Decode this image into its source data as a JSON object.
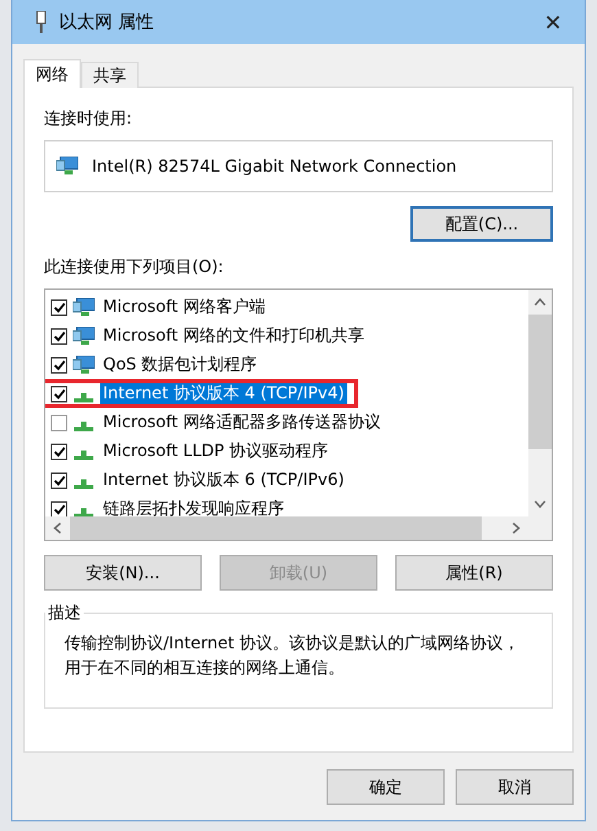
{
  "window": {
    "title": "以太网 属性",
    "close": "✕"
  },
  "tabs": [
    {
      "label": "网络",
      "selected": true
    },
    {
      "label": "共享",
      "selected": false
    }
  ],
  "connect_using": {
    "label": "连接时使用:",
    "adapter": "Intel(R) 82574L Gigabit Network Connection",
    "configure_button": "配置(C)..."
  },
  "items_label": "此连接使用下列项目(O):",
  "items": [
    {
      "label": "Microsoft 网络客户端",
      "kind": "client",
      "checked": true,
      "selected": false,
      "annotated": false
    },
    {
      "label": "Microsoft 网络的文件和打印机共享",
      "kind": "client",
      "checked": true,
      "selected": false,
      "annotated": false
    },
    {
      "label": "QoS 数据包计划程序",
      "kind": "client",
      "checked": true,
      "selected": false,
      "annotated": false
    },
    {
      "label": "Internet 协议版本 4 (TCP/IPv4)",
      "kind": "protocol",
      "checked": true,
      "selected": true,
      "annotated": true
    },
    {
      "label": "Microsoft 网络适配器多路传送器协议",
      "kind": "protocol",
      "checked": false,
      "selected": false,
      "annotated": false
    },
    {
      "label": "Microsoft LLDP 协议驱动程序",
      "kind": "protocol",
      "checked": true,
      "selected": false,
      "annotated": false
    },
    {
      "label": "Internet 协议版本 6 (TCP/IPv6)",
      "kind": "protocol",
      "checked": true,
      "selected": false,
      "annotated": false
    },
    {
      "label": "链路层拓扑发现响应程序",
      "kind": "protocol",
      "checked": true,
      "selected": false,
      "annotated": false
    }
  ],
  "item_buttons": [
    {
      "label": "安装(N)...",
      "disabled": false
    },
    {
      "label": "卸载(U)",
      "disabled": true
    },
    {
      "label": "属性(R)",
      "disabled": false
    }
  ],
  "description": {
    "title": "描述",
    "text": "传输控制协议/Internet 协议。该协议是默认的广域网络协议，用于在不同的相互连接的网络上通信。"
  },
  "dialog_buttons": [
    "确定",
    "取消"
  ]
}
